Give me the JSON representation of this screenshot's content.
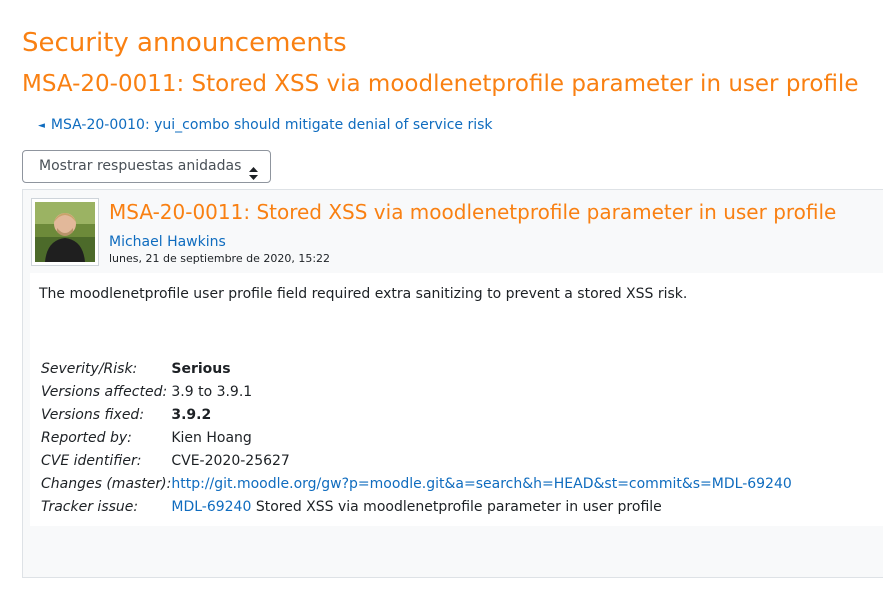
{
  "forum": {
    "title": "Security announcements"
  },
  "discussion": {
    "title": "MSA-20-0011: Stored XSS via moodlenetprofile parameter in user profile",
    "prev_arrow": "◄",
    "prev_link": "MSA-20-0010: yui_combo should mitigate denial of service risk"
  },
  "display_mode": {
    "selected": "Mostrar respuestas anidadas"
  },
  "post": {
    "subject": "MSA-20-0011: Stored XSS via moodlenetprofile parameter in user profile",
    "author": "Michael Hawkins",
    "date": "lunes, 21 de septiembre de 2020, 15:22",
    "message": "The moodlenetprofile user profile field required extra sanitizing to prevent a stored XSS risk.",
    "details": {
      "severity_label": "Severity/Risk:",
      "severity_value": "Serious",
      "affected_label": "Versions affected:",
      "affected_value": "3.9 to 3.9.1",
      "fixed_label": "Versions fixed:",
      "fixed_value": "3.9.2",
      "reported_label": "Reported by:",
      "reported_value": "Kien Hoang",
      "cve_label": "CVE identifier:",
      "cve_value": "CVE-2020-25627",
      "changes_label": "Changes (master):",
      "changes_value": "http://git.moodle.org/gw?p=moodle.git&a=search&h=HEAD&st=commit&s=MDL-69240",
      "tracker_label": "Tracker issue:",
      "tracker_link": "MDL-69240",
      "tracker_text": " Stored XSS via moodlenetprofile parameter in user profile"
    }
  },
  "colors": {
    "accent_orange": "#f98012",
    "link_blue": "#0f6cbf"
  }
}
